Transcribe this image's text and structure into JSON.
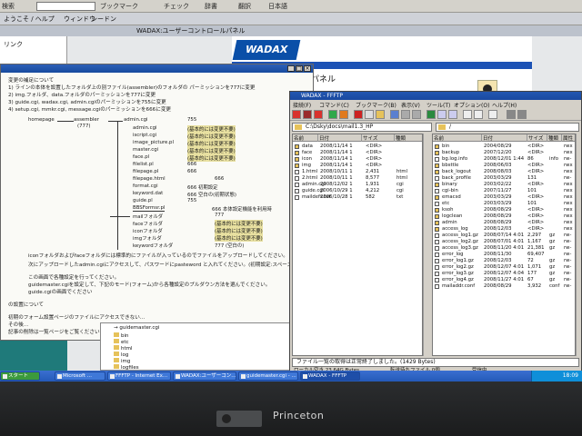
{
  "browser": {
    "toolbar": {
      "search_value": "",
      "items": [
        "検索",
        "ブックマーク",
        "チェック",
        "辞書",
        "翻訳",
        "日本語"
      ]
    },
    "links": [
      "ようこそ / ヘルプ",
      "ウィンドウ",
      "シードン"
    ],
    "tab_title": "WADAX:ユーザーコントロールパネル",
    "sidebar_items": [
      "リンク"
    ]
  },
  "wadax": {
    "logo": "WADAX",
    "title": "パネル"
  },
  "doc_window": {
    "title": "",
    "lines": [
      "変更の補足について",
      "1) ラインの本体を設置したフォルダ上の別ファイル(assembler)のフォルダの パーミッションを777に変更",
      "2) img.フォルダ、data.フォルダのパーミッションを777に変更",
      "3) guide.cgi, wadax.cgi, admin.cgiのパーミッションを755に変更",
      "4) setup.cgi, mmkr.cgi, message.cgiのパーミッションを666に変更"
    ],
    "tree": {
      "root": "homepage",
      "assembler": "assembler",
      "assembler_perm": "(777)",
      "admin": "admin.cgi",
      "admin_perm": "755",
      "files": [
        {
          "name": "admin.cgi",
          "note": "(基本的には変更不要)"
        },
        {
          "name": "iscript.cgi",
          "note": "(基本的には変更不要)"
        },
        {
          "name": "image_picture.pl",
          "note": "(基本的には変更不要)"
        },
        {
          "name": "master.cgi",
          "note": "(基本的には変更不要)"
        },
        {
          "name": "face.pl",
          "note": "(基本的には変更不要)"
        },
        {
          "name": "filelist.pl",
          "note": "666"
        },
        {
          "name": "filepage.pl",
          "note": "666"
        },
        {
          "name": "filepage.html",
          "note": "666"
        },
        {
          "name": "format.cgi",
          "note": "666 初期設定"
        },
        {
          "name": "keyword.dat",
          "note": "666 空白の(初期状態)"
        },
        {
          "name": "guide.pl",
          "note": "755"
        },
        {
          "name": "BBSFormsr.pl",
          "note": "666 本体設定機能を利用時"
        }
      ],
      "folders": [
        {
          "name": "mailフォルダ",
          "note": "777"
        },
        {
          "name": "faceフォルダ",
          "note": "(基本的には変更不要)"
        },
        {
          "name": "iconフォルダ",
          "note": "(基本的には変更不要)"
        },
        {
          "name": "imgフォルダ",
          "note": "(基本的には変更不要)"
        },
        {
          "name": "keywordフォルダ",
          "note": "777 (空白の)"
        }
      ]
    },
    "notes": [
      "iconフォルダおよびfaceフォルダには標準的にファイルが入っているのでファイルをアップロードしてください。",
      "次にアップロードしたadmin.cgiにアクセスして、パスワードにpasteword と入れてください。(初期設定:スペース)",
      "この画面で各種設定を行ってください。",
      "guidemaster.cgiを設定して、下記のモード(フォーム)から各種設定のプルダウン方法を選んでください。",
      "guide.cgiの画面でください",
      "の設置について",
      "初期のフォーム設置ページのファイルにアクセスできない...",
      "その後...",
      "記事の削除は一覧ページをご覧ください",
      "→ guidemaster.cgi"
    ],
    "cgi_label": "guidemaster.cgi"
  },
  "ftp": {
    "title": "WADAX - FFFTP",
    "menu": [
      "接続(F)",
      "コマンド(C)",
      "ブックマーク(B)",
      "表示(V)",
      "ツール(T)",
      "オプション(O)",
      "ヘルプ(H)"
    ],
    "local_path": "C:\\Dsky\\docs\\mail1.3_HP",
    "remote_path": "/",
    "local_headers": [
      "名前",
      "日付",
      "サイズ",
      "種類"
    ],
    "remote_headers": [
      "名前",
      "日付",
      "サイズ",
      "種類",
      "属性"
    ],
    "local_files": [
      {
        "name": "data",
        "date": "2008/11/14 1",
        "size": "<DIR>",
        "type": ""
      },
      {
        "name": "face",
        "date": "2008/11/14 1",
        "size": "<DIR>",
        "type": ""
      },
      {
        "name": "icon",
        "date": "2008/11/14 1",
        "size": "<DIR>",
        "type": ""
      },
      {
        "name": "img",
        "date": "2008/11/14 1",
        "size": "<DIR>",
        "type": ""
      },
      {
        "name": "1.html",
        "date": "2008/10/11 1",
        "size": "2,431",
        "type": "html"
      },
      {
        "name": "2.html",
        "date": "2008/10/11 1",
        "size": "8,577",
        "type": "html"
      },
      {
        "name": "admin.cgi",
        "date": "2008/12/02 1",
        "size": "1,931",
        "type": "cgi"
      },
      {
        "name": "guide.cgi",
        "date": "2006/10/29 1",
        "size": "4,212",
        "type": "cgi"
      },
      {
        "name": "maildefs.txt",
        "date": "2006/10/28 1",
        "size": "582",
        "type": "txt"
      }
    ],
    "remote_files": [
      {
        "name": "bin",
        "date": "2004/08/29",
        "size": "<DIR>",
        "type": "",
        "attr": "rwx"
      },
      {
        "name": "backup",
        "date": "2007/12/20",
        "size": "<DIR>",
        "type": "",
        "attr": "rwx"
      },
      {
        "name": "bg.log.info",
        "date": "2008/12/01 1:44",
        "size": "86",
        "type": "info",
        "attr": "rw-"
      },
      {
        "name": "bbsttle",
        "date": "2008/06/03",
        "size": "<DIR>",
        "type": "",
        "attr": "rwx"
      },
      {
        "name": "back_logout",
        "date": "2008/08/03",
        "size": "<DIR>",
        "type": "",
        "attr": "rwx"
      },
      {
        "name": "back_profile",
        "date": "2003/03/29",
        "size": "131",
        "type": "",
        "attr": "rw-"
      },
      {
        "name": "binary",
        "date": "2003/02/22",
        "size": "<DIR>",
        "type": "",
        "attr": "rwx"
      },
      {
        "name": "cgi-bin",
        "date": "2007/11/27",
        "size": "101",
        "type": "",
        "attr": "rwx"
      },
      {
        "name": "emacsd",
        "date": "2003/03/29",
        "size": "<DIR>",
        "type": "",
        "attr": "rwx"
      },
      {
        "name": "etc",
        "date": "2003/03/29",
        "size": "101",
        "type": "",
        "attr": "rwx"
      },
      {
        "name": "ksoh",
        "date": "2008/08/29",
        "size": "<DIR>",
        "type": "",
        "attr": "rwx"
      },
      {
        "name": "logclean",
        "date": "2008/08/29",
        "size": "<DIR>",
        "type": "",
        "attr": "rwx"
      },
      {
        "name": "admin",
        "date": "2008/08/29",
        "size": "<DIR>",
        "type": "",
        "attr": "rwx"
      },
      {
        "name": "access_log",
        "date": "2008/12/03",
        "size": "<DIR>",
        "type": "",
        "attr": "rwx"
      },
      {
        "name": "access_log1.gz",
        "date": "2008/07/14 4:01",
        "size": "2,297",
        "type": "gz",
        "attr": "rw-"
      },
      {
        "name": "access_log2.gz",
        "date": "2008/07/01 4:01",
        "size": "1,167",
        "type": "gz",
        "attr": "rw-"
      },
      {
        "name": "access_log3.gz",
        "date": "2008/11/20 4:01",
        "size": "21,381",
        "type": "gz",
        "attr": "rw-"
      },
      {
        "name": "error_log",
        "date": "2008/11/30",
        "size": "69,407",
        "type": "",
        "attr": "rw-"
      },
      {
        "name": "error_log1.gz",
        "date": "2008/12/03",
        "size": "72",
        "type": "gz",
        "attr": "rw-"
      },
      {
        "name": "error_log2.gz",
        "date": "2008/12/07 4:01",
        "size": "1,071",
        "type": "gz",
        "attr": "rw-"
      },
      {
        "name": "error_log3.gz",
        "date": "2008/12/07 4:04",
        "size": "177",
        "type": "gz",
        "attr": "rw-"
      },
      {
        "name": "error_log4.gz",
        "date": "2008/11/27 4:01",
        "size": "67",
        "type": "gz",
        "attr": "rw-"
      },
      {
        "name": "mailaddr.conf",
        "date": "2008/08/29",
        "size": "3,932",
        "type": "conf",
        "attr": "rw-"
      }
    ],
    "log_text": "ファイル一覧の取得は正常終了しました。(1429 Bytes)",
    "status": [
      "ローカル空き 23.64G Bytes",
      "転送待ちファイル 0個",
      "受信中"
    ]
  },
  "explorer": {
    "items": [
      "bin",
      "etc",
      "html",
      "log",
      "img",
      "logfiles",
      "picture"
    ]
  },
  "taskbar": {
    "buttons": [
      "スタート",
      "Microsoft ...",
      "FFFTP - Internet Ex...",
      "WADAX:ユーザーコン...",
      "guidemaster.cgi - ...",
      "WADAX - FFFTP"
    ],
    "time": "18:09"
  },
  "monitor": {
    "brand": "Princeton"
  },
  "colors": {
    "titlebar": "#1a49a0",
    "taskbar": "#245ab8",
    "tray": "#0f8fd9",
    "wadax_blue": "#0a4fa8"
  }
}
